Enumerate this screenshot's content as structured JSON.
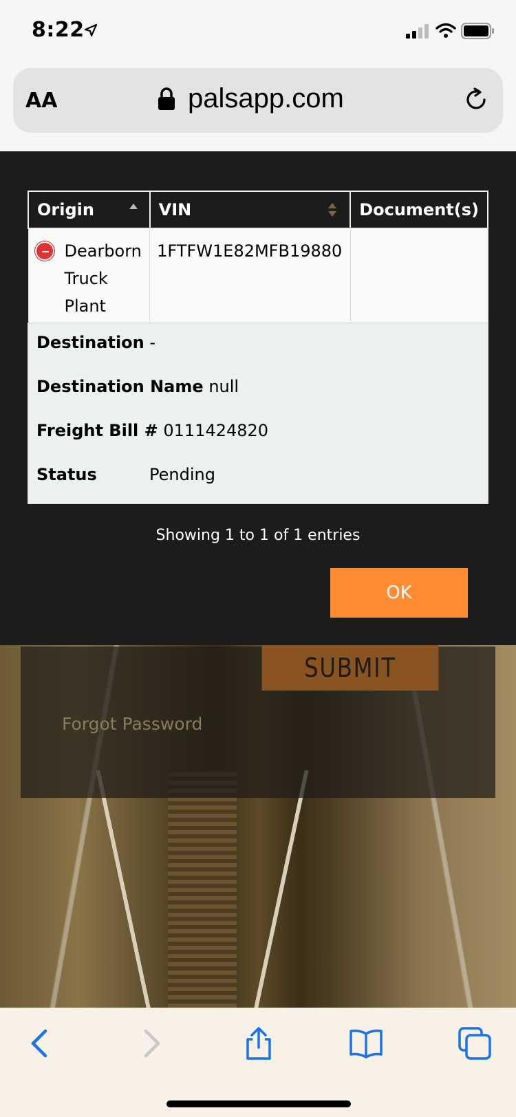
{
  "status_bar": {
    "time": "8:22"
  },
  "browser": {
    "text_size_label": "AA",
    "url": "palsapp.com"
  },
  "background_page": {
    "submit_label": "SUBMIT",
    "forgot_password_label": "Forgot Password"
  },
  "modal": {
    "table": {
      "headers": [
        "Origin",
        "VIN",
        "Document(s)"
      ],
      "rows": [
        {
          "origin": "Dearborn Truck Plant",
          "vin": "1FTFW1E82MFB19880",
          "documents": ""
        }
      ]
    },
    "details": {
      "destination_label": "Destination",
      "destination_value": "-",
      "destination_name_label": "Destination Name",
      "destination_name_value": "null",
      "freight_bill_label": "Freight Bill #",
      "freight_bill_value": "0111424820",
      "status_label": "Status",
      "status_value": "Pending"
    },
    "entries_info": "Showing 1 to 1 of 1 entries",
    "ok_label": "OK"
  },
  "colors": {
    "modal_bg": "#1c1c1c",
    "ok_button": "#ff8c32",
    "ios_blue": "#1a73e8",
    "collapse_red": "#dd3333"
  }
}
